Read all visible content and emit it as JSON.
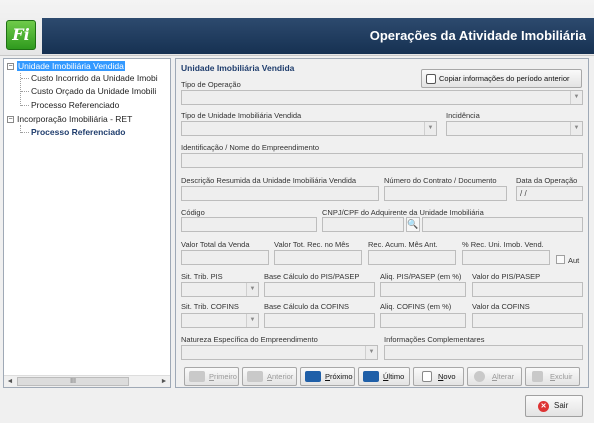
{
  "app": {
    "logo_text": "Fi",
    "title": "Operações da Atividade Imobiliária"
  },
  "tree": {
    "nodes": [
      {
        "label": "Unidade Imobiliária Vendida",
        "selected": true
      },
      {
        "label": "Custo Incorrido da Unidade Imobi"
      },
      {
        "label": "Custo Orçado da Unidade Imobili"
      },
      {
        "label": "Processo Referenciado"
      },
      {
        "label": "Incorporação Imobiliária - RET"
      },
      {
        "label": "Processo Referenciado"
      }
    ],
    "expander_minus": "−",
    "scroll_left": "◄",
    "scroll_right": "►",
    "scroll_thumb": "III"
  },
  "form": {
    "section_title": "Unidade Imobiliária Vendida",
    "copy_button": "Copiar informações do período anterior",
    "labels": {
      "tipo_operacao": "Tipo de Operação",
      "tipo_unidade": "Tipo de Unidade Imobiliária Vendida",
      "incidencia": "Incidência",
      "identificacao": "Identificação / Nome do Empreendimento",
      "descricao": "Descrição Resumida da Unidade Imobiliária Vendida",
      "numero_contrato": "Número do Contrato / Documento",
      "data_operacao": "Data da Operação",
      "codigo": "Código",
      "cnpj": "CNPJ/CPF do Adquirente da Unidade Imobiliária",
      "valor_total": "Valor Total da Venda",
      "valor_tot_rec": "Valor Tot. Rec. no Mês",
      "rec_acum": "Rec. Acum. Mês Ant.",
      "perc_rec": "% Rec. Uni. Imob. Vend.",
      "aut": "Aut",
      "sit_pis": "Sit. Trib. PIS",
      "base_pis": "Base Cálculo do PIS/PASEP",
      "aliq_pis": "Aliq. PIS/PASEP (em %)",
      "valor_pis": "Valor do PIS/PASEP",
      "sit_cofins": "Sit. Trib. COFINS",
      "base_cofins": "Base Cálculo da COFINS",
      "aliq_cofins": "Aliq. COFINS (em %)",
      "valor_cofins": "Valor da COFINS",
      "natureza": "Natureza Específica do Empreendimento",
      "info_compl": "Informações Complementares"
    },
    "values": {
      "data_operacao": " / /"
    },
    "dropdown_arrow": "▼",
    "search_glyph": "🔍"
  },
  "nav_buttons": [
    {
      "label": "Primeiro",
      "enabled": false
    },
    {
      "label": "Anterior",
      "enabled": false
    },
    {
      "label": "Próximo",
      "enabled": true
    },
    {
      "label": "Último",
      "enabled": true
    },
    {
      "label": "Novo",
      "enabled": true
    },
    {
      "label": "Alterar",
      "enabled": false
    },
    {
      "label": "Excluir",
      "enabled": false
    }
  ],
  "footer": {
    "exit_button": "Sair",
    "exit_icon_glyph": "✕"
  },
  "colors": {
    "header_blue": "#1d3a5f",
    "selection": "#3399ff",
    "logo_green": "#3fa62a",
    "nav_icon_blue": "#1f5fa8"
  }
}
